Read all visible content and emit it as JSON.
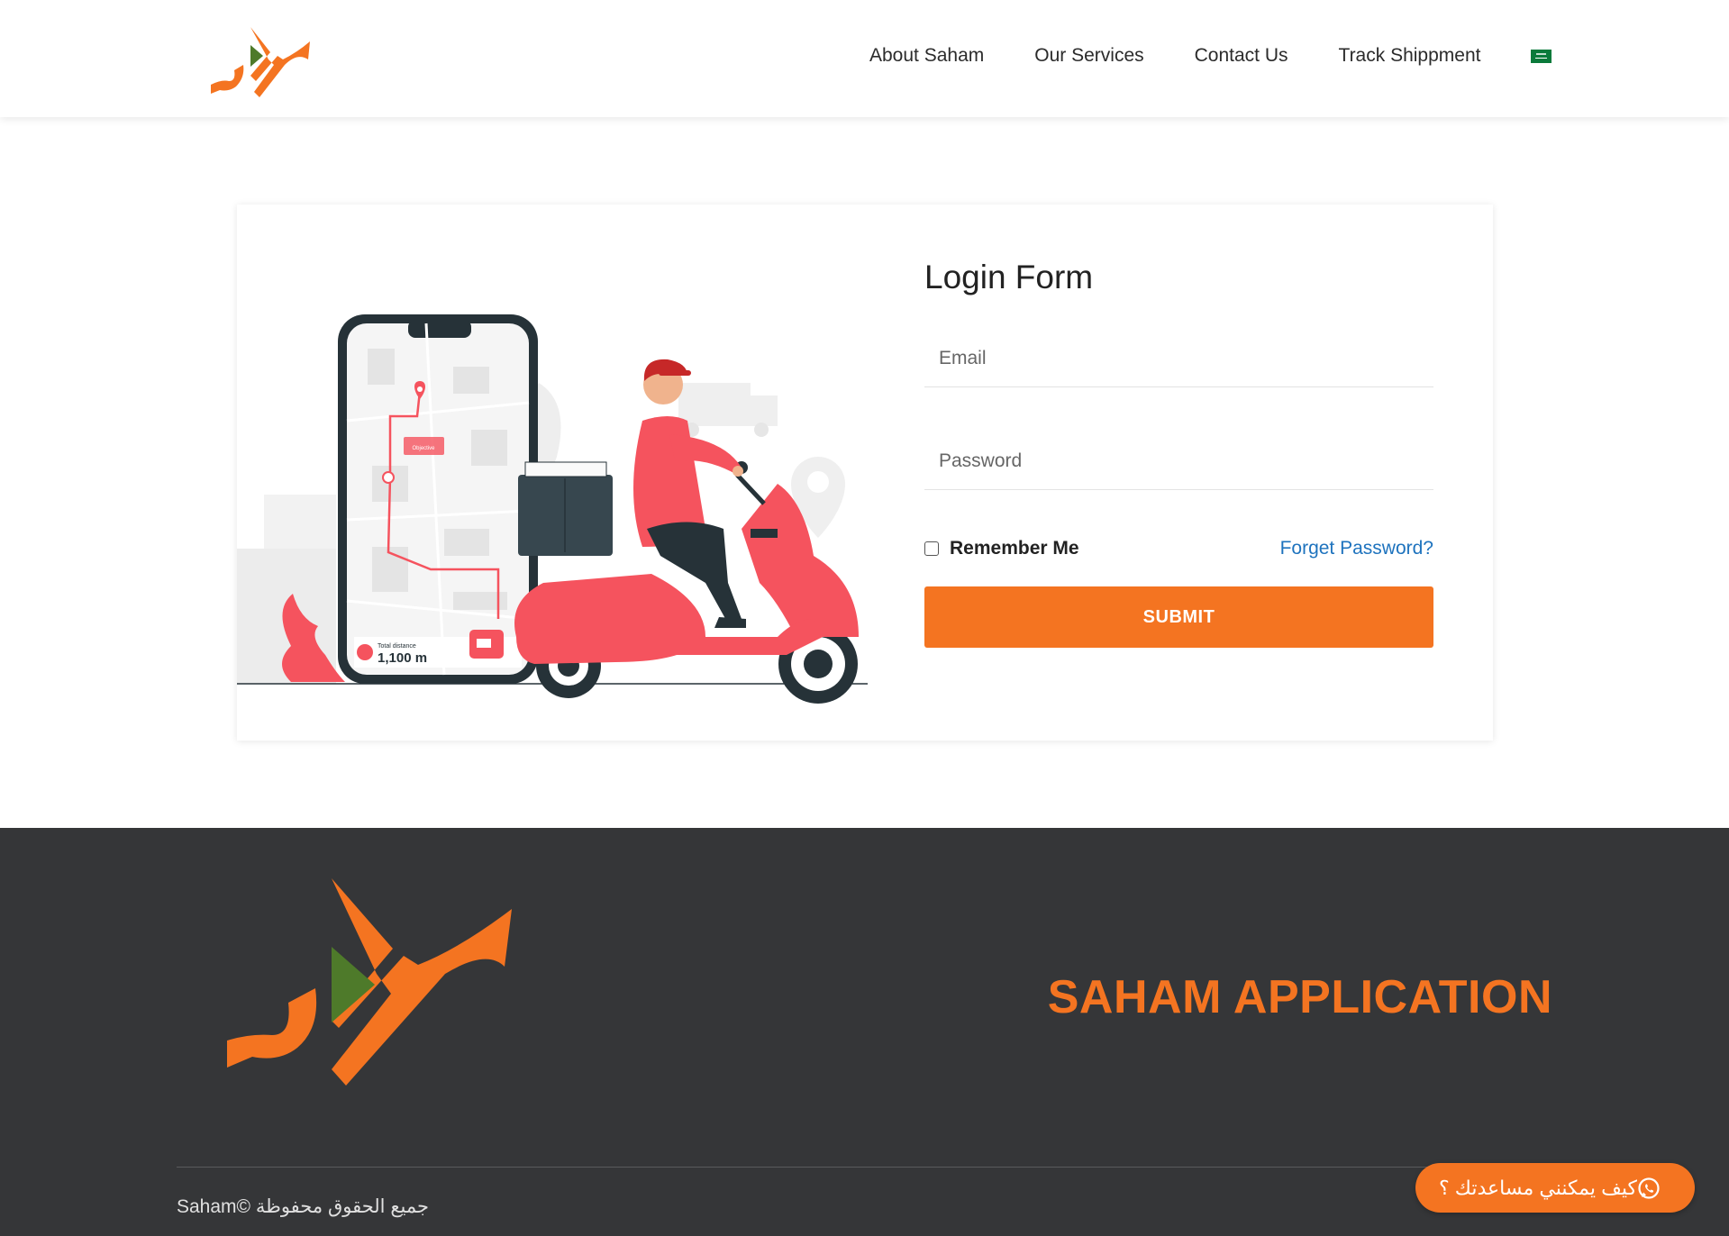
{
  "nav": {
    "items": [
      {
        "label": "About Saham"
      },
      {
        "label": "Our Services"
      },
      {
        "label": "Contact Us"
      },
      {
        "label": "Track Shippment"
      }
    ],
    "language_flag": "saudi-flag-icon"
  },
  "illustration": {
    "phone_label": "Total distance",
    "distance": "1,100 m",
    "tag": "Objective"
  },
  "login": {
    "title": "Login Form",
    "email_placeholder": "Email",
    "password_placeholder": "Password",
    "remember_label": "Remember Me",
    "forget_label": "Forget Password?",
    "submit_label": "SUBMIT"
  },
  "footer": {
    "title": "SAHAM APPLICATION",
    "copyright": "Saham© جميع الحقوق محفوظة"
  },
  "whatsapp": {
    "label": "كيف يمكنني مساعدتك ؟"
  },
  "colors": {
    "brand_orange": "#f47421",
    "brand_green": "#4e7a2a",
    "footer_bg": "#353638",
    "link_blue": "#1e73be"
  }
}
